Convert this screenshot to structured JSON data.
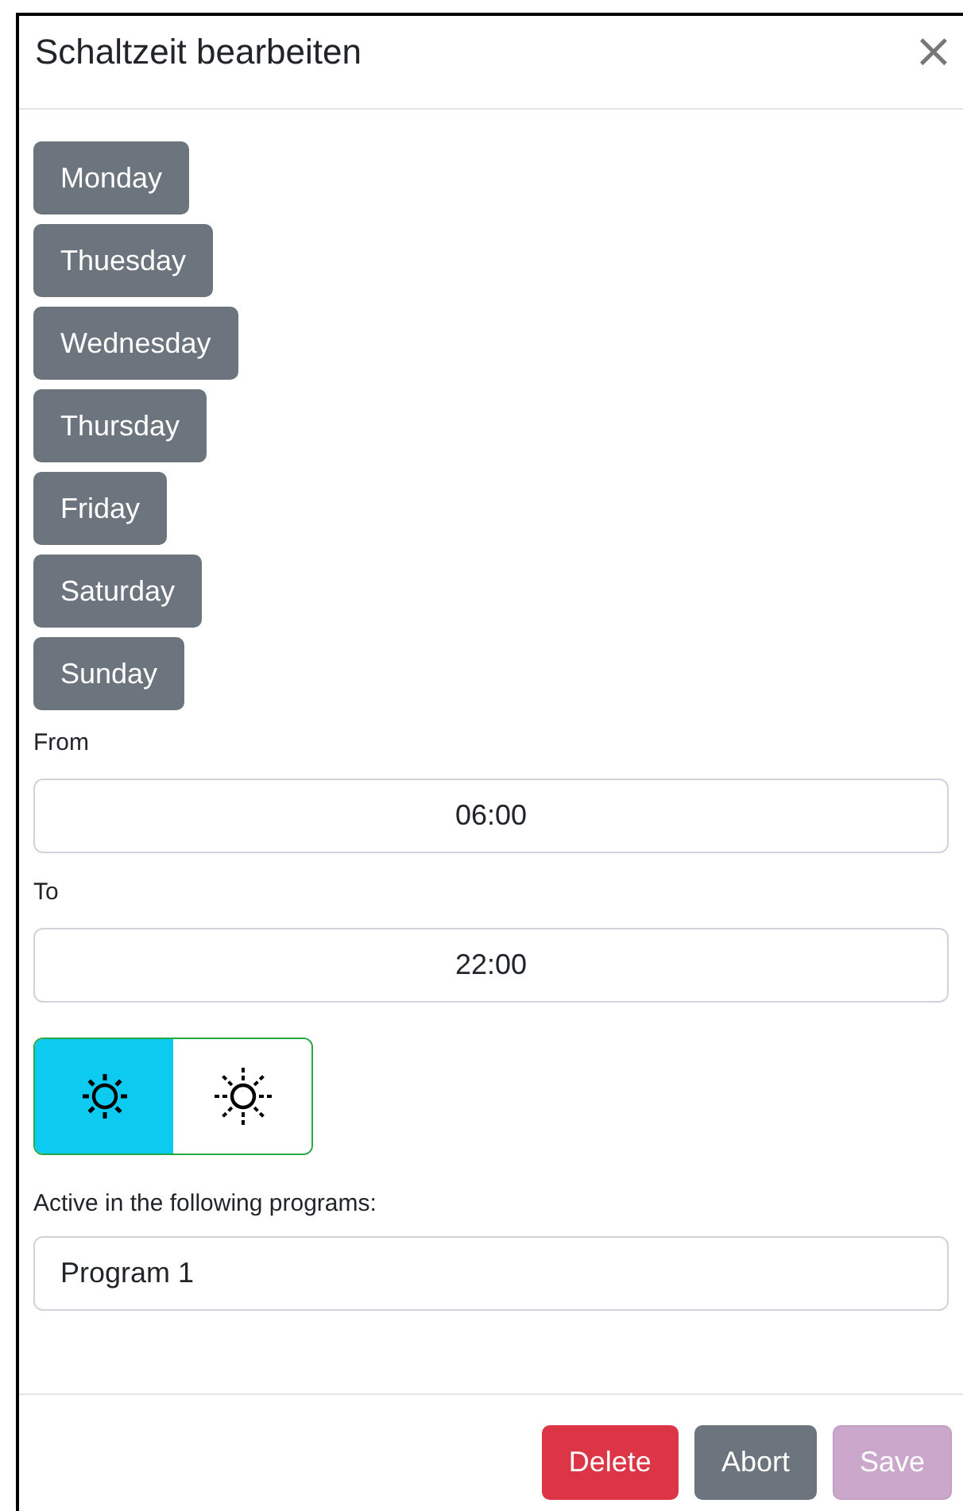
{
  "dialog": {
    "title": "Schaltzeit bearbeiten",
    "close": "×"
  },
  "days": [
    {
      "label": "Monday",
      "selected": true
    },
    {
      "label": "Thuesday",
      "selected": true
    },
    {
      "label": "Wednesday",
      "selected": true
    },
    {
      "label": "Thursday",
      "selected": true
    },
    {
      "label": "Friday",
      "selected": true
    },
    {
      "label": "Saturday",
      "selected": true
    },
    {
      "label": "Sunday",
      "selected": true
    }
  ],
  "from": {
    "label": "From",
    "value": "06:00"
  },
  "to": {
    "label": "To",
    "value": "22:00"
  },
  "modes": [
    {
      "kind": "full",
      "selected": true
    },
    {
      "kind": "dim",
      "selected": false
    }
  ],
  "programs": {
    "label": "Active in the following programs:",
    "value": "Program 1"
  },
  "buttons": [
    {
      "kind": "danger",
      "label": "Delete",
      "disabled": false
    },
    {
      "kind": "secondary",
      "label": "Abort",
      "disabled": false
    },
    {
      "kind": "primary",
      "label": "Save",
      "disabled": true
    }
  ]
}
